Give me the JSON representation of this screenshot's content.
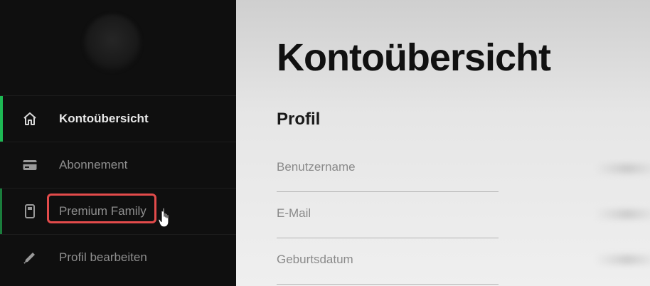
{
  "sidebar": {
    "items": [
      {
        "label": "Kontoübersicht",
        "icon": "home-icon",
        "active": true
      },
      {
        "label": "Abonnement",
        "icon": "credit-card-icon",
        "active": false
      },
      {
        "label": "Premium Family",
        "icon": "family-device-icon",
        "active": false
      },
      {
        "label": "Profil bearbeiten",
        "icon": "pencil-icon",
        "active": false
      }
    ]
  },
  "main": {
    "title": "Kontoübersicht",
    "section_title": "Profil",
    "fields": [
      {
        "label": "Benutzername"
      },
      {
        "label": "E-Mail"
      },
      {
        "label": "Geburtsdatum"
      }
    ]
  },
  "colors": {
    "accent": "#1db954",
    "highlight": "#e24b4b"
  }
}
